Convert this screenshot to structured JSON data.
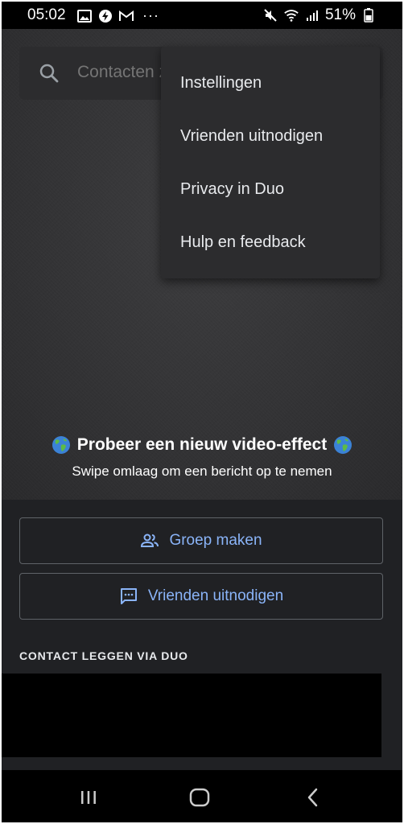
{
  "status_bar": {
    "time": "05:02",
    "battery": "51%",
    "left_icons": [
      "gallery-icon",
      "bolt-icon",
      "gmail-icon",
      "more-dots-icon"
    ],
    "right_icons": [
      "mute-icon",
      "wifi-icon",
      "signal-icon",
      "battery-icon"
    ]
  },
  "search": {
    "placeholder": "Contacten zoeken"
  },
  "menu": {
    "items": [
      {
        "label": "Instellingen"
      },
      {
        "label": "Vrienden uitnodigen"
      },
      {
        "label": "Privacy in Duo"
      },
      {
        "label": "Hulp en feedback"
      }
    ]
  },
  "promo": {
    "title": "Probeer een nieuw video-effect",
    "subtitle": "Swipe omlaag om een bericht op te nemen"
  },
  "actions": {
    "group_label": "Groep maken",
    "invite_label": "Vrienden uitnodigen"
  },
  "section": {
    "title": "CONTACT LEGGEN VIA DUO"
  },
  "colors": {
    "accent": "#8ab4f8",
    "background": "#202124",
    "menu_background": "#2c2c2e"
  }
}
